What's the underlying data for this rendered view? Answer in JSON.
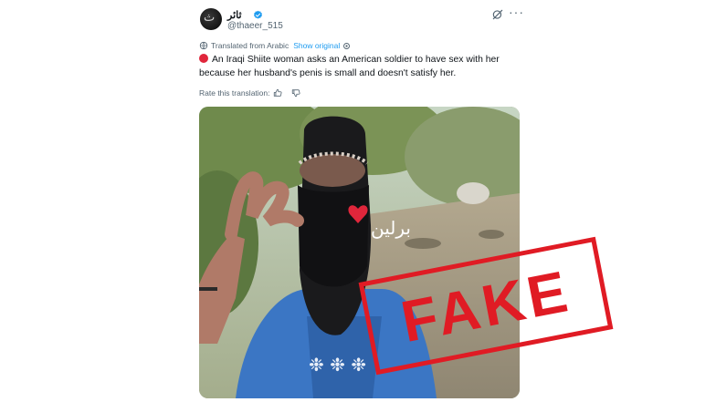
{
  "author": {
    "display_name": "ثائر",
    "handle": "@thaeer_515",
    "avatar_glyph": "ث"
  },
  "translation": {
    "label": "Translated from Arabic",
    "show_original": "Show original"
  },
  "tweet": {
    "text": "An Iraqi Shiite woman asks an American soldier to have sex with her because her husband's penis is small and doesn't satisfy her."
  },
  "rate": {
    "label": "Rate this translation:"
  },
  "media": {
    "overlay_text": "برلين"
  },
  "stamp": {
    "text": "FAKE",
    "color": "#e01b24"
  },
  "colors": {
    "accent": "#1d9bf0",
    "secondary_text": "#536471",
    "red_dot": "#e0263b"
  },
  "icons": [
    "verified-badge-icon",
    "grok-icon",
    "more-icon",
    "translate-icon",
    "thumbs-up-icon",
    "thumbs-down-icon"
  ]
}
